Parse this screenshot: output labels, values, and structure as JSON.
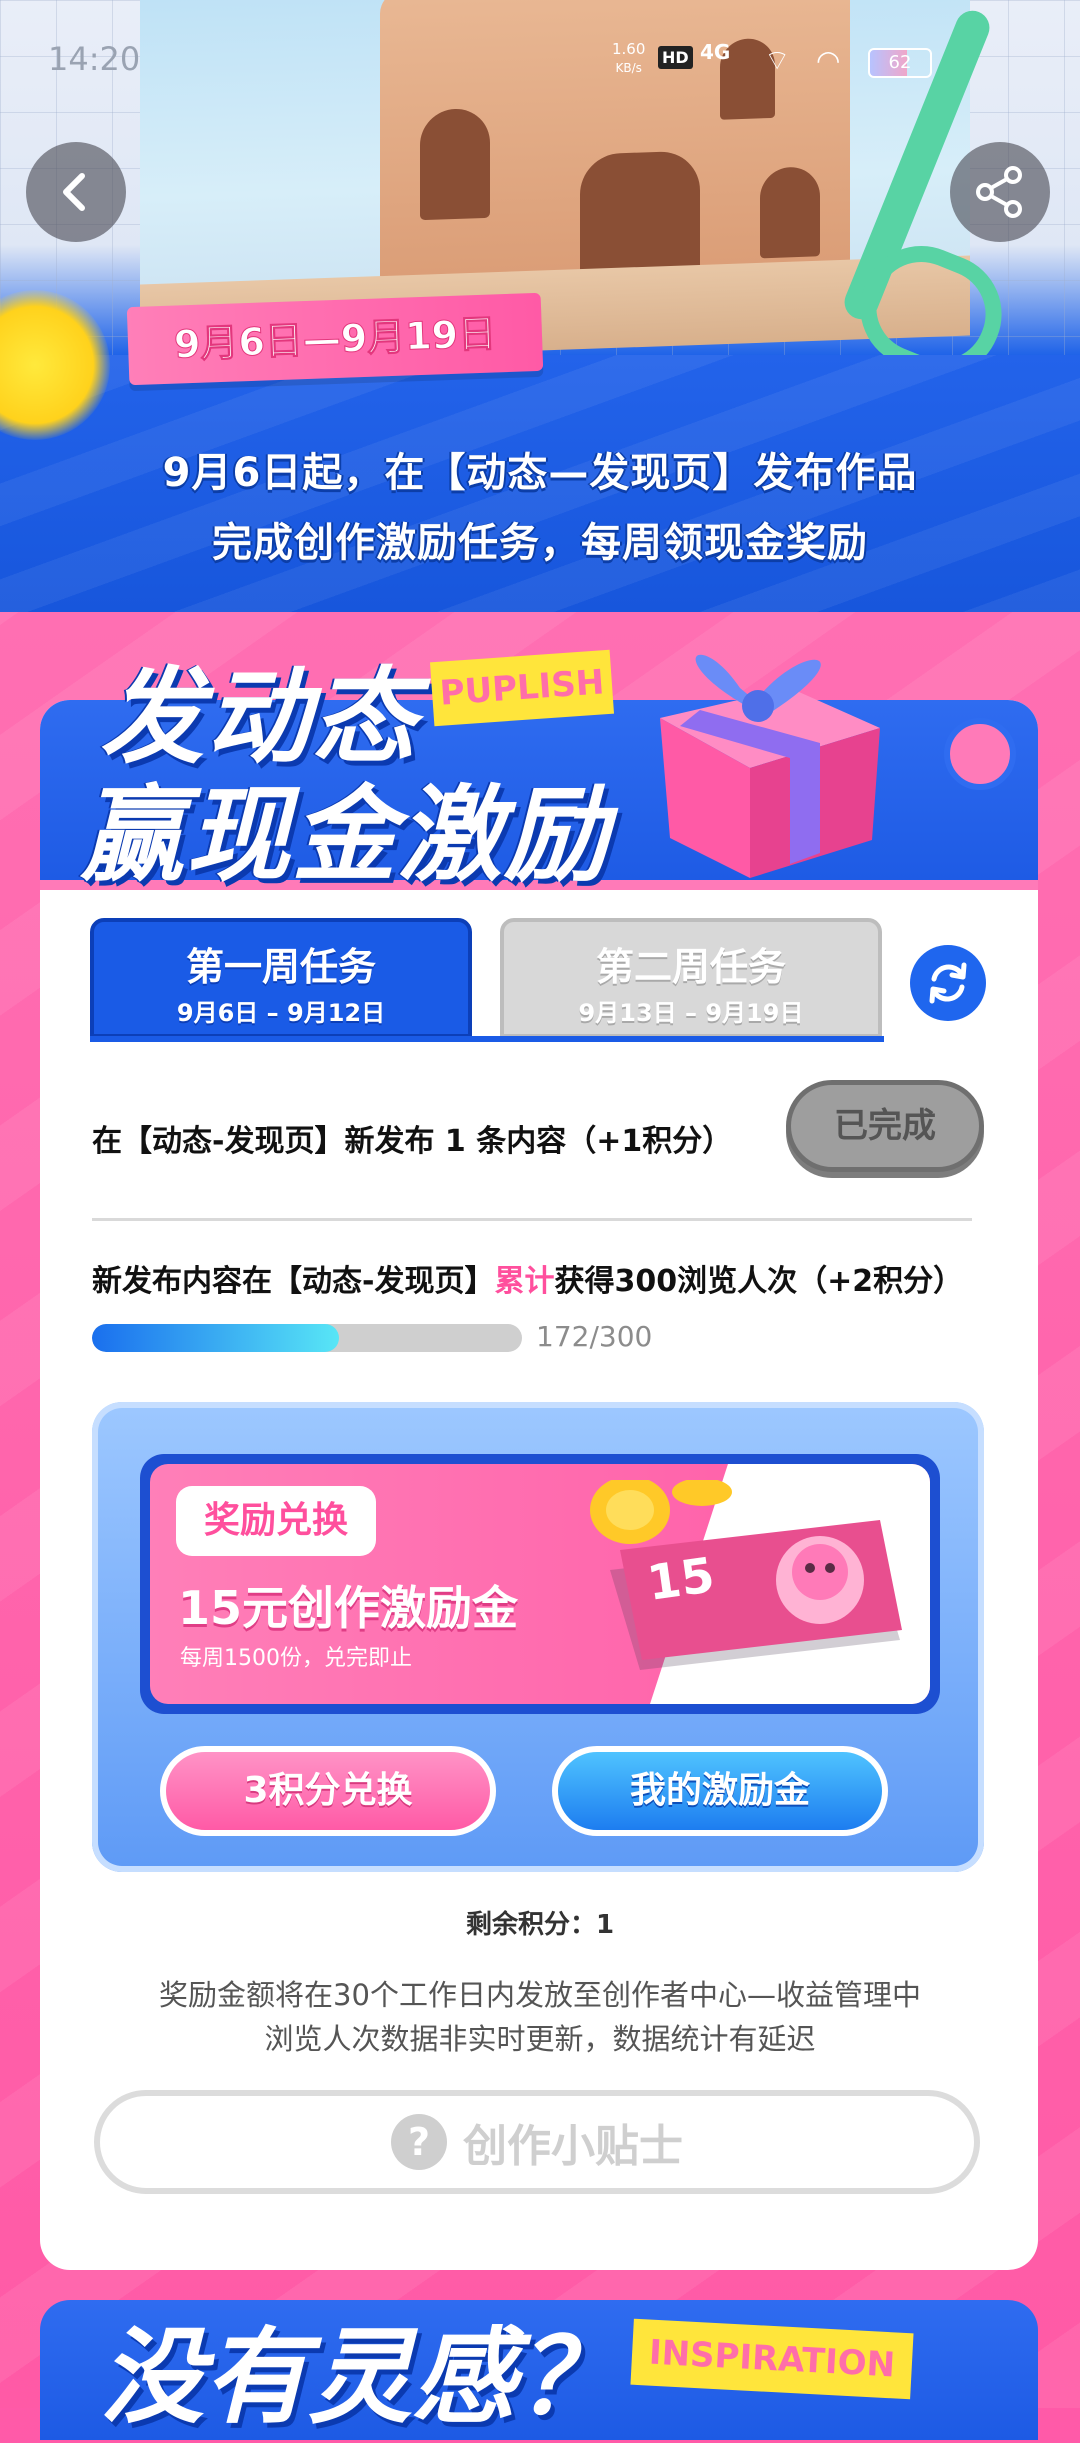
{
  "status_bar": {
    "time": "14:20",
    "speed_value": "1.60",
    "speed_unit": "KB/s",
    "hd": "HD",
    "network": "4G",
    "battery": "62"
  },
  "nav": {
    "back_icon": "chevron-left-icon",
    "share_icon": "share-icon"
  },
  "hero": {
    "date_range": "9月6日—9月19日",
    "line1": "9月6日起，在【动态—发现页】发布作品",
    "line2": "完成创作激励任务，每周领现金奖励"
  },
  "card": {
    "title_line1": "发动态",
    "title_line2": "赢现金激励",
    "badge": "PUPLISH",
    "tabs": [
      {
        "label": "第一周任务",
        "dates": "9月6日 – 9月12日",
        "active": true
      },
      {
        "label": "第二周任务",
        "dates": "9月13日 – 9月19日",
        "active": false
      }
    ],
    "task1": {
      "text": "在【动态-发现页】新发布 1 条内容（+1积分）",
      "status": "已完成"
    },
    "task2": {
      "text_before": "新发布内容在【动态-发现页】",
      "highlight": "累计",
      "text_after": "获得300浏览人次（+2积分）",
      "progress_current": 172,
      "progress_total": 300,
      "progress_label": "172/300"
    },
    "reward": {
      "tag": "奖励兑换",
      "title": "15元创作激励金",
      "subtitle": "每周1500份，兑完即止",
      "ticket_number": "15",
      "redeem_button": "3积分兑换",
      "mine_button": "我的激励金"
    },
    "remaining": "剩余积分：1",
    "note_line1": "奖励金额将在30个工作日内发放至创作者中心—收益管理中",
    "note_line2": "浏览人次数据非实时更新，数据统计有延迟",
    "tips_button": "创作小贴士"
  },
  "next_section": {
    "title": "没有灵感？",
    "badge": "INSPIRATION"
  },
  "colors": {
    "brand_blue": "#1d5ae4",
    "brand_pink": "#ff5aa6",
    "accent_yellow": "#ffe53b"
  }
}
